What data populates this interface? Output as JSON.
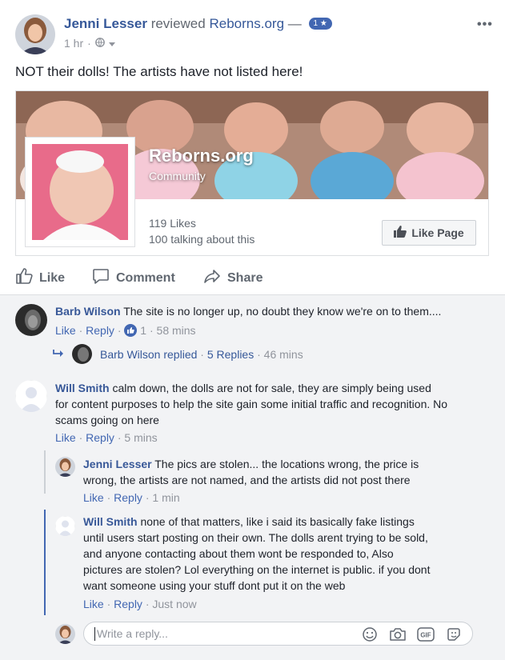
{
  "post": {
    "author": "Jenni Lesser",
    "action": "reviewed",
    "page": "Reborns.org",
    "dash": "—",
    "rating": "1",
    "time": "1 hr",
    "text": "NOT their dolls! The artists have not listed here!"
  },
  "card": {
    "title": "Reborns.org",
    "category": "Community",
    "likes": "119 Likes",
    "talking": "100 talking about this",
    "like_page_label": "Like Page"
  },
  "actions": {
    "like": "Like",
    "comment": "Comment",
    "share": "Share"
  },
  "comments": [
    {
      "name": "Barb Wilson",
      "text": "The site is no longer up, no doubt they know we're on to them....",
      "like": "Like",
      "reply": "Reply",
      "reactions": "1",
      "time": "58 mins",
      "replies_summary": {
        "name": "Barb Wilson",
        "verb": "replied",
        "count": "5 Replies",
        "time": "46 mins"
      }
    },
    {
      "name": "Will Smith",
      "text_lines": [
        "calm down, the dolls are not for sale, they are simply being used",
        "for content purposes to help the site gain some initial traffic and recognition. No",
        "scams going on here"
      ],
      "like": "Like",
      "reply": "Reply",
      "time": "5 mins",
      "replies": [
        {
          "name": "Jenni Lesser",
          "text_lines": [
            "The pics are stolen... the locations wrong, the price is",
            "wrong, the artists are not named, and the artists did not post there"
          ],
          "like": "Like",
          "reply": "Reply",
          "time": "1 min"
        },
        {
          "name": "Will Smith",
          "text_lines": [
            "none of that matters, like i said its basically fake listings",
            "until users start posting on their own. The dolls arent trying to be sold,",
            "and anyone contacting about them wont be responded to, Also",
            "pictures are stolen? Lol everything on the internet is public. if you dont",
            "want someone using your stuff dont put it on the web"
          ],
          "like": "Like",
          "reply": "Reply",
          "time": "Just now"
        }
      ]
    }
  ],
  "reply_box": {
    "placeholder": "Write a reply..."
  },
  "colors": {
    "link": "#385898",
    "accent": "#4267b2",
    "muted": "#90949c",
    "comments_bg": "#f2f3f5"
  },
  "icons": [
    "globe-icon",
    "thumbs-up-icon",
    "comment-icon",
    "share-icon",
    "emoji-icon",
    "camera-icon",
    "gif-icon",
    "sticker-icon"
  ]
}
